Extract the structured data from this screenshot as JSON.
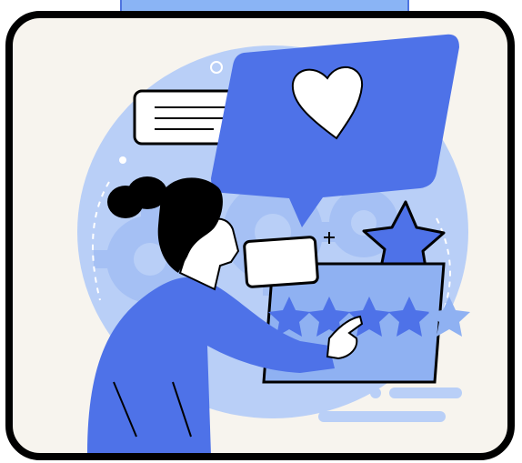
{
  "illustration": {
    "subject": "",
    "colors": {
      "accent": "#4e72e8",
      "light_blue": "#b9cff7",
      "mid_blue": "#8fb1f2",
      "outline": "#000000",
      "background": "#f7f4ee",
      "white": "#ffffff"
    },
    "icons": [
      "heart-icon",
      "star-icon",
      "gear-icon",
      "sparkle-icon"
    ],
    "rating": {
      "filled": 5,
      "max": 5
    }
  }
}
